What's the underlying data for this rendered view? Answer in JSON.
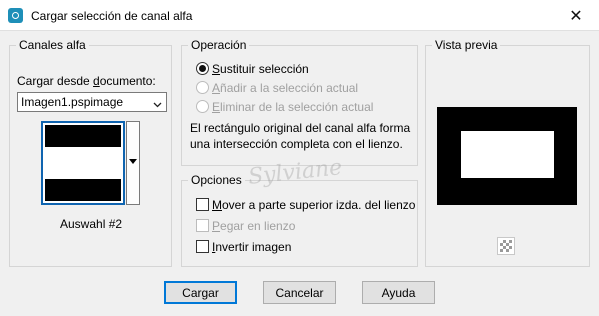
{
  "window": {
    "title": "Cargar selección de canal alfa",
    "close_glyph": "✕"
  },
  "canales": {
    "legend": "Canales alfa",
    "load_label_pre": "Cargar desde ",
    "load_label_u": "d",
    "load_label_post": "ocumento:",
    "document_value": "Imagen1.pspimage",
    "channel_name": "Auswahl #2"
  },
  "operacion": {
    "legend": "Operación",
    "options": [
      {
        "u": "S",
        "rest": "ustituir selección",
        "checked": true,
        "disabled": false
      },
      {
        "u": "A",
        "rest": "ñadir a la selección actual",
        "checked": false,
        "disabled": true
      },
      {
        "u": "E",
        "rest": "liminar de la selección actual",
        "checked": false,
        "disabled": true
      }
    ],
    "description": "El rectángulo original del canal alfa forma una intersección completa con el lienzo."
  },
  "opciones": {
    "legend": "Opciones",
    "items": [
      {
        "u": "M",
        "rest": "over a parte superior izda. del lienzo",
        "disabled": false
      },
      {
        "u": "P",
        "rest": "egar en lienzo",
        "disabled": true
      },
      {
        "u": "I",
        "rest": "nvertir imagen",
        "disabled": false
      }
    ]
  },
  "preview": {
    "legend": "Vista previa",
    "zoom_icon": "checker-icon"
  },
  "watermark": "Sylviane",
  "buttons": {
    "ok": "Cargar",
    "cancel": "Cancelar",
    "help": "Ayuda"
  },
  "colors": {
    "accent": "#0078d7",
    "title_icon": "#1e8fb8"
  }
}
